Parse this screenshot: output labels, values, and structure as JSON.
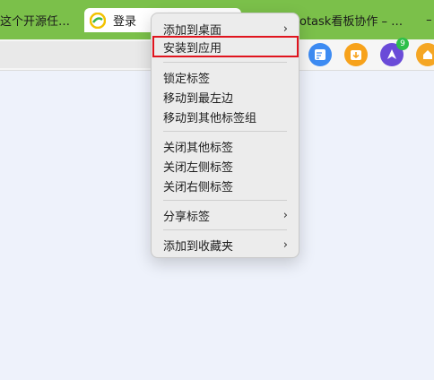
{
  "tabs": {
    "left_title": "这个开源任…",
    "active_title": "登录",
    "right_title": "otask看板协作 – …",
    "right_dash": "–"
  },
  "toolbar": {
    "extensions": [
      {
        "name": "note-extension-icon"
      },
      {
        "name": "download-extension-icon"
      },
      {
        "name": "ai-extension-icon",
        "badge": "9"
      },
      {
        "name": "home-extension-icon"
      }
    ]
  },
  "context_menu": {
    "items": {
      "add_to_desktop": "添加到桌面",
      "install_as_app": "安装到应用",
      "pin_tab": "锁定标签",
      "move_to_leftmost": "移动到最左边",
      "move_to_group": "移动到其他标签组",
      "close_others": "关闭其他标签",
      "close_left": "关闭左侧标签",
      "close_right": "关闭右侧标签",
      "share_tab": "分享标签",
      "add_to_favorites": "添加到收藏夹"
    },
    "chevron": "›"
  },
  "colors": {
    "tabstrip": "#7bc04a",
    "highlight": "#e0141e",
    "page_bg": "#eef2fb"
  }
}
